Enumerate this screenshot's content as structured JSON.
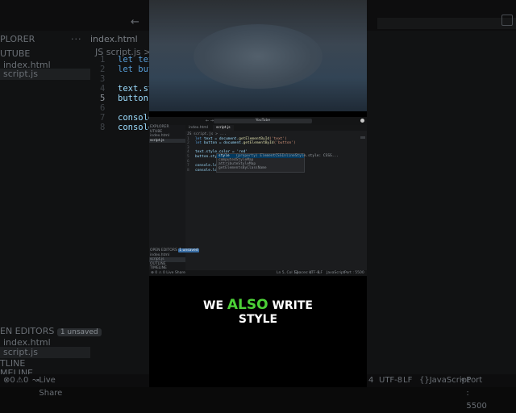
{
  "background": {
    "explorer_title": "PLORER",
    "folder": "UTUBE",
    "files": [
      "index.html",
      "script.js"
    ],
    "active_tab": "index.html",
    "breadcrumb": "JS script.js >",
    "line_numbers": [
      "1",
      "2",
      "3",
      "4",
      "5",
      "6",
      "7",
      "8"
    ],
    "code_lines": [
      "let text",
      "let butto",
      "",
      "text.styl",
      "button.st",
      "",
      "console.l",
      "console.l"
    ],
    "open_editors_label": "EN EDITORS",
    "unsaved_badge": "1 unsaved",
    "open_files": [
      "index.html",
      "script.js"
    ],
    "outline": "TLINE",
    "timeline": "MELINE",
    "status_left": [
      "0",
      "0"
    ],
    "live_share": "Live Share",
    "status_right": [
      "4",
      "UTF-8",
      "LF",
      "JavaScript",
      "Port : 5500"
    ]
  },
  "editor_window": {
    "search_text": "YouTube",
    "nav_arrows": "← →",
    "explorer_title": "EXPLORER",
    "folder": "UTUBE",
    "files": [
      "index.html",
      "script.js"
    ],
    "tabs": [
      "index.html",
      "script.js"
    ],
    "breadcrumb": "JS script.js > ...",
    "line_numbers": [
      "1",
      "2",
      "3",
      "4",
      "5",
      "6",
      "7",
      "8"
    ],
    "code": {
      "l1_kw": "let",
      "l1_rest": " text = document.",
      "l1_fn": "getElementById",
      "l1_arg": "('text')",
      "l2_kw": "let",
      "l2_rest": " button = document.",
      "l2_fn": "getElementById",
      "l2_arg": "('button')",
      "l4": "text.style.color = 'red'",
      "l5": "button.style",
      "l7": "console.log(",
      "l8": "console.log("
    },
    "suggestions": [
      {
        "name": "style",
        "detail": "(property) ElementCSSInlineStyle.style: CSSS..."
      },
      {
        "name": "computedStyleMap",
        "detail": ""
      },
      {
        "name": "attributeStyleMap",
        "detail": ""
      },
      {
        "name": "getElementsByClassName",
        "detail": ""
      }
    ],
    "open_editors_label": "OPEN EDITORS",
    "unsaved_badge": "1 unsaved",
    "open_files": [
      "index.html",
      "script.js"
    ],
    "outline": "OUTLINE",
    "timeline": "TIMELINE",
    "status_left": "⊗ 0 ⚠ 0  Live Share",
    "status_right": [
      "Ln 5, Col 13",
      "Spaces: 4",
      "UTF-8",
      "LF",
      "JavaScript",
      "Port : 5500"
    ]
  },
  "caption": {
    "before": "WE",
    "highlight": "ALSO",
    "after": "WRITE",
    "line2": "STYLE",
    "highlight_color": "#4cd137"
  }
}
